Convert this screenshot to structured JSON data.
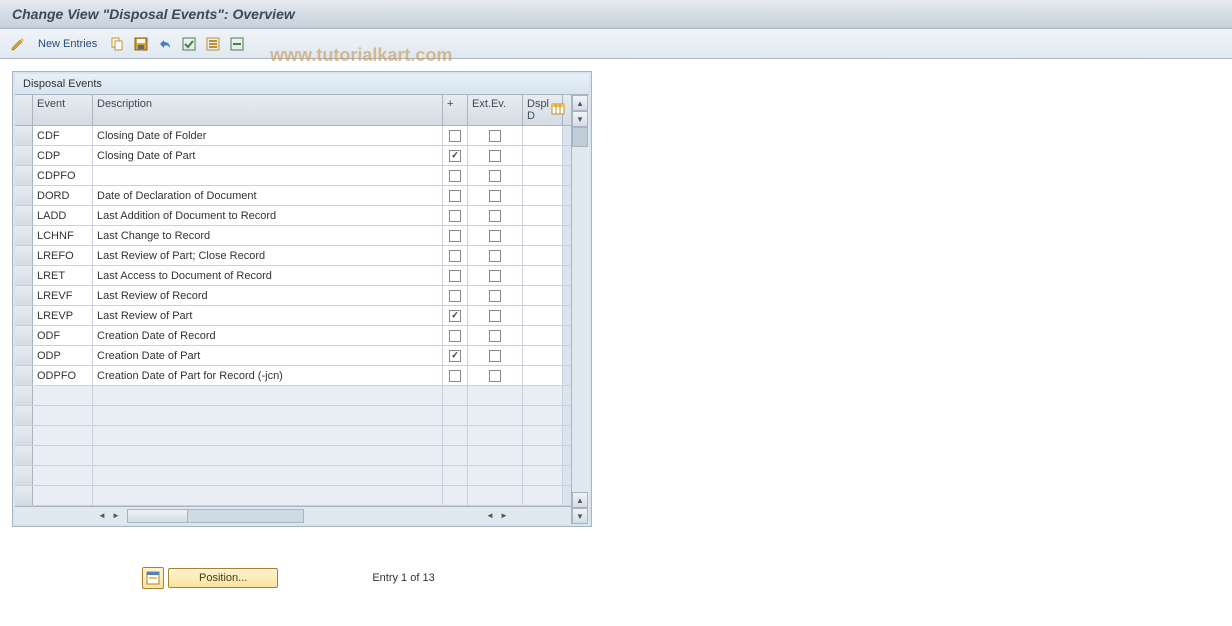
{
  "title": "Change View \"Disposal Events\": Overview",
  "toolbar": {
    "new_entries_label": "New Entries"
  },
  "watermark": "www.tutorialkart.com",
  "table": {
    "title": "Disposal Events",
    "headers": {
      "event": "Event",
      "description": "Description",
      "plus": "+",
      "extev": "Ext.Ev.",
      "dspl": "Dspl D"
    },
    "rows": [
      {
        "event": "CDF",
        "description": "Closing Date of Folder",
        "plus": false,
        "extev": false
      },
      {
        "event": "CDP",
        "description": "Closing Date of Part",
        "plus": true,
        "extev": false
      },
      {
        "event": "CDPFO",
        "description": "",
        "plus": false,
        "extev": false
      },
      {
        "event": "DORD",
        "description": "Date of Declaration of Document",
        "plus": false,
        "extev": false
      },
      {
        "event": "LADD",
        "description": "Last Addition of Document to Record",
        "plus": false,
        "extev": false
      },
      {
        "event": "LCHNF",
        "description": "Last Change to Record",
        "plus": false,
        "extev": false
      },
      {
        "event": "LREFO",
        "description": "Last Review of Part; Close Record",
        "plus": false,
        "extev": false
      },
      {
        "event": "LRET",
        "description": "Last Access to Document of Record",
        "plus": false,
        "extev": false
      },
      {
        "event": "LREVF",
        "description": "Last Review of Record",
        "plus": false,
        "extev": false
      },
      {
        "event": "LREVP",
        "description": "Last Review of Part",
        "plus": true,
        "extev": false
      },
      {
        "event": "ODF",
        "description": "Creation Date of Record",
        "plus": false,
        "extev": false
      },
      {
        "event": "ODP",
        "description": "Creation Date of Part",
        "plus": true,
        "extev": false
      },
      {
        "event": "ODPFO",
        "description": "Creation Date of Part for Record (-jcn)",
        "plus": false,
        "extev": false
      }
    ],
    "empty_rows": 6
  },
  "footer": {
    "position_label": "Position...",
    "entry_text": "Entry 1 of 13"
  }
}
